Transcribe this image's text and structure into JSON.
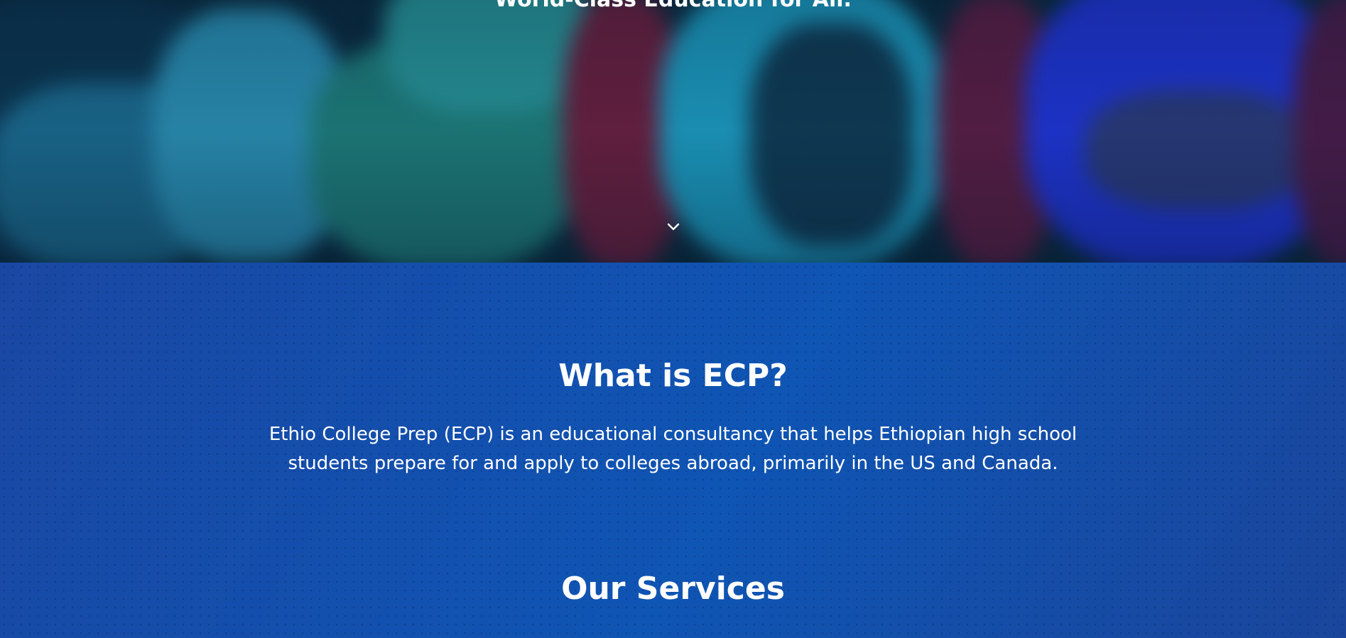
{
  "hero": {
    "tagline": "World-Class Education for All.",
    "scroll_icon": "chevron-down-icon"
  },
  "about": {
    "title": "What is ECP?",
    "description": "Ethio College Prep (ECP) is an educational consultancy that helps Ethiopian high school students prepare for and apply to colleges abroad, primarily in the US and Canada."
  },
  "services": {
    "title": "Our Services"
  },
  "colors": {
    "section_background": "#134ea6",
    "text": "#ffffff"
  }
}
